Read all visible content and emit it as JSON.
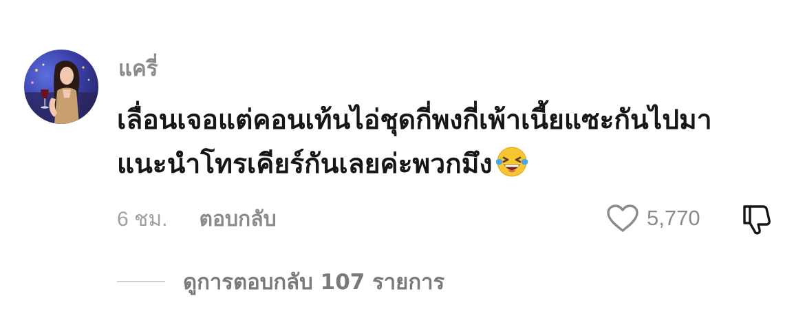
{
  "comment": {
    "avatar": "profile-photo",
    "username": "แครี่",
    "text_line1": "เลื่อนเจอแต่คอนเท้นไอ่ชุดกี่พงกี่เพ้าเนี้ยแซะกันไปมา",
    "text_line2": "แนะนำโทรเคียร์กันเลยค่ะพวกมึง",
    "emoji": "face-with-tears-of-joy",
    "timestamp": "6 ชม.",
    "reply_label": "ตอบกลับ",
    "like_count": "5,770",
    "like_icon": "heart-outline",
    "dislike_icon": "thumbs-down-outline",
    "view_replies_label": "ดูการตอบกลับ 107 รายการ"
  },
  "colors": {
    "background": "#ffffff",
    "text_primary": "#161616",
    "text_secondary": "#8a8a8e",
    "divider": "#cfcfd3",
    "emoji_face": "#f7c531",
    "emoji_tears": "#4aa8e8"
  }
}
